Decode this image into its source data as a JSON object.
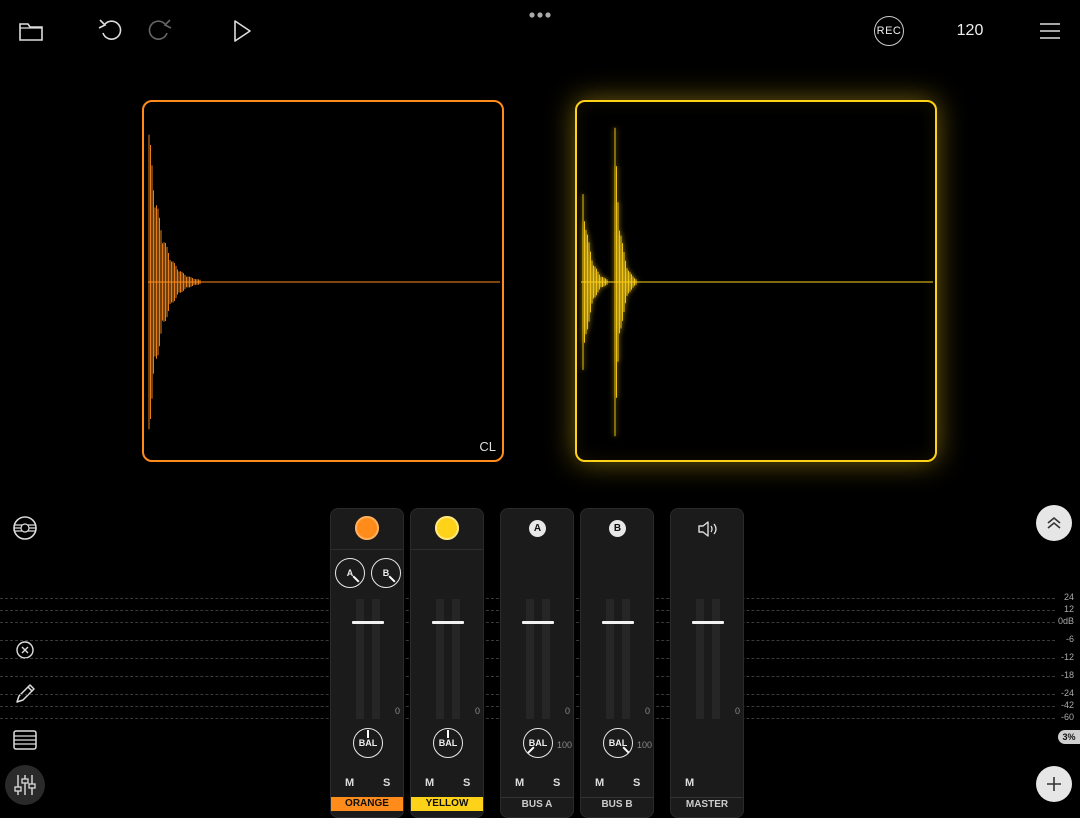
{
  "toolbar": {
    "icons": [
      "folder-icon",
      "undo-icon",
      "redo-icon",
      "play-icon",
      "menu-icon"
    ],
    "rec_label": "REC",
    "bpm": "120"
  },
  "pads": [
    {
      "color": "#ff8c1a",
      "label": "CL"
    },
    {
      "color": "#ffd21a",
      "label": ""
    }
  ],
  "sidebar": {
    "icons": [
      "record-disc-icon",
      "close-circle-icon",
      "pencil-icon",
      "list-icon",
      "mixer-sliders-icon"
    ]
  },
  "db_scale": [
    "24",
    "12",
    "0dB",
    "-6",
    "-12",
    "-18",
    "-24",
    "-42",
    "-60"
  ],
  "mixer": {
    "strips": [
      {
        "name": "ORANGE",
        "color": "#ff8c1a",
        "meter_zero": "0",
        "mute": "M",
        "solo": "S",
        "knob": "BAL",
        "send_a": "A",
        "send_b": "B"
      },
      {
        "name": "YELLOW",
        "color": "#ffd21a",
        "meter_zero": "0",
        "mute": "M",
        "solo": "S",
        "knob": "BAL"
      },
      {
        "name": "BUS A",
        "badge": "A",
        "meter_zero": "0",
        "mute": "M",
        "solo": "S",
        "knob": "BAL",
        "knob_value": "100"
      },
      {
        "name": "BUS B",
        "badge": "B",
        "meter_zero": "0",
        "mute": "M",
        "solo": "S",
        "knob": "BAL",
        "knob_value": "100"
      },
      {
        "name": "MASTER",
        "meter_zero": "0",
        "mute": "M"
      }
    ]
  },
  "right_controls": {
    "zoom_percent": "3%"
  },
  "colors": {
    "orange": "#ff8c1a",
    "yellow": "#ffd21a",
    "background": "#000000"
  }
}
